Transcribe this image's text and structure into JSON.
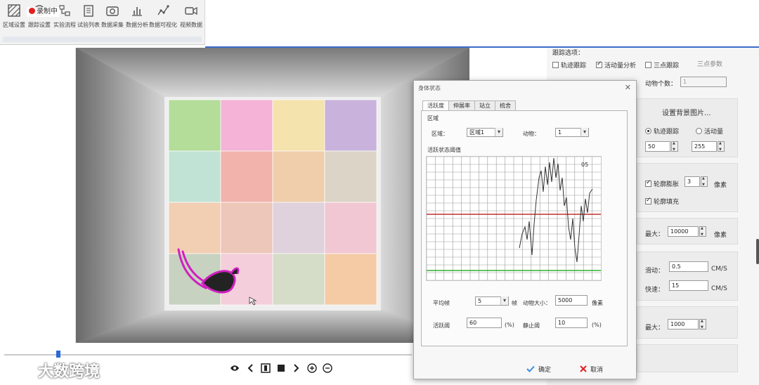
{
  "toolbar": {
    "items": [
      {
        "label": "区域设置",
        "icon": "grid-hatch-icon"
      },
      {
        "label": "跟踪设置",
        "icon": "target-icon"
      },
      {
        "label": "实验流程",
        "icon": "flow-icon"
      },
      {
        "label": "试验列表",
        "icon": "clipboard-icon"
      },
      {
        "label": "数据采集",
        "icon": "camera-icon"
      },
      {
        "label": "数据分析",
        "icon": "bar-chart-icon"
      },
      {
        "label": "数据可视化",
        "icon": "line-graph-icon"
      },
      {
        "label": "视频数据",
        "icon": "video-camera-icon"
      }
    ],
    "recording_badge": "录制中"
  },
  "arena": {
    "cell_colors": [
      [
        "#a8d98a",
        "#f5a8d2",
        "#f5e0a0",
        "#c2a8d8"
      ],
      [
        "#b8e0d0",
        "#f2a8a0",
        "#f0c8a0",
        "#d8d0c0"
      ],
      [
        "#f2c8a8",
        "#ecc0b0",
        "#dcccd8",
        "#f0c0cc"
      ],
      [
        "#c0ccb8",
        "#f5c8d6",
        "#d0d8c0",
        "#f5c498"
      ]
    ],
    "trail_color": "#d020c0"
  },
  "right_panel": {
    "tracking_options_title": "跟踪选项：",
    "track_trace": "轨迹跟踪",
    "activity_analysis": "活动量分析",
    "three_point_track": "三点跟踪",
    "three_point_params": "三点参数",
    "animal_count_label": "动物个数：",
    "animal_count_value": "1",
    "set_background": "设置背景图片...",
    "radio_trace": "轨迹跟踪",
    "radio_activity": "活动量",
    "value_a": "50",
    "value_b": "255",
    "contour_expand": "轮廓膨胀",
    "contour_expand_value": "3",
    "unit_pixel": "像素",
    "contour_fill": "轮廓填充",
    "max_label": "最大：",
    "max_value_1": "10000",
    "unit_pixel_2": "像素",
    "move_label": "滑动：",
    "move_value": "0.5",
    "unit_cms": "CM/S",
    "fast_label": "快速：",
    "fast_value": "15",
    "unit_cms_2": "CM/S",
    "max_label_2": "最大：",
    "max_value_2": "1000"
  },
  "dialog": {
    "title": "身体状态",
    "tabs": [
      "活跃度",
      "伸展率",
      "站立",
      "梳舍"
    ],
    "region_group": "区域",
    "region_label": "区域：",
    "region_value": "区域1",
    "animal_label": "动物：",
    "animal_value": "1",
    "threshold_group": "活跃状态阈值",
    "graph_label": "05",
    "avg_frames_label": "平均帧",
    "avg_frames_value": "5",
    "frames_unit": "帧",
    "animal_size_label": "动物大小：",
    "animal_size_value": "5000",
    "pixel_unit": "像素",
    "active_threshold_label": "活跃阈",
    "active_threshold_value": "60",
    "percent_1": "(%)",
    "still_threshold_label": "静止阈",
    "still_threshold_value": "10",
    "percent_2": "(%)",
    "ok_label": "确定",
    "cancel_label": "取消",
    "line_colors": {
      "upper": "#c03030",
      "lower": "#30b030"
    }
  },
  "watermark": "大数跨境"
}
